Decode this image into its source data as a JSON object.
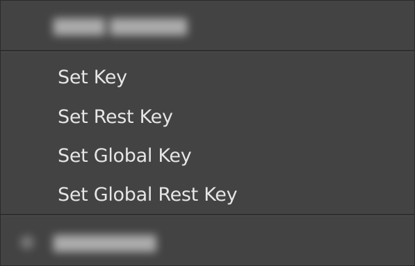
{
  "menu": {
    "items": [
      {
        "label": "Set Key"
      },
      {
        "label": "Set Rest Key"
      },
      {
        "label": "Set Global Key"
      },
      {
        "label": "Set Global Rest Key"
      }
    ]
  }
}
